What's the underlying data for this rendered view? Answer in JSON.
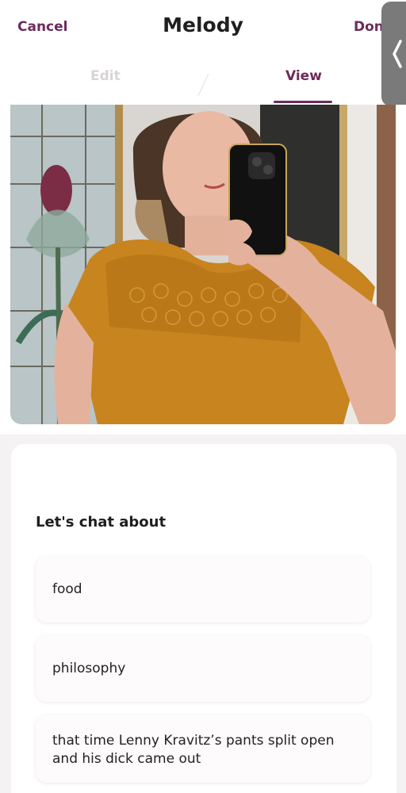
{
  "header": {
    "cancel_label": "Cancel",
    "title": "Melody",
    "done_label": "Don"
  },
  "tabs": [
    {
      "label": "Edit",
      "active": false
    },
    {
      "label": "View",
      "active": true
    }
  ],
  "photo": {
    "icon": "profile-photo"
  },
  "prompts": {
    "heading": "Let's chat about",
    "topics": [
      "food",
      "philosophy",
      "that time Lenny Kravitz’s pants split open and his dick came out"
    ]
  },
  "colors": {
    "accent": "#6d2b5c",
    "tab_inactive": "#d8d4d6",
    "background": "#f4f2f3",
    "card": "#ffffff",
    "side_handle": "#7a7a7a"
  },
  "icons": [
    "chevron-left-icon"
  ]
}
